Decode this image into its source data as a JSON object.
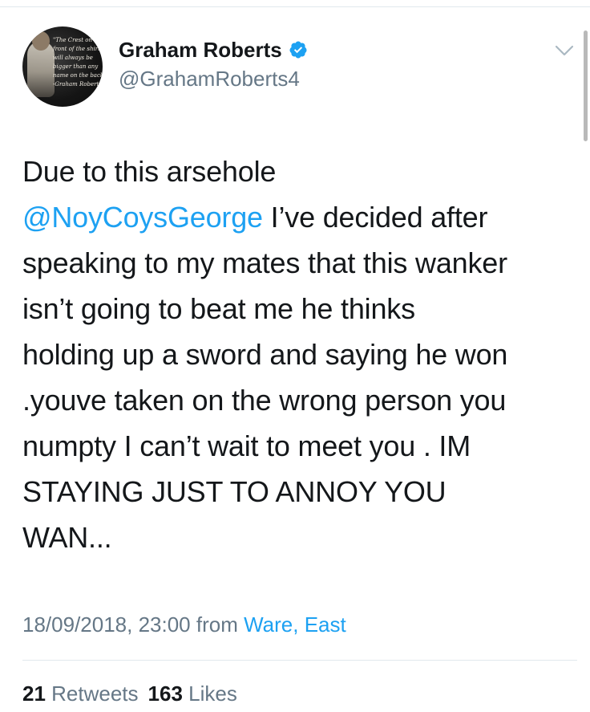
{
  "user": {
    "display_name": "Graham Roberts",
    "handle": "@GrahamRoberts4",
    "verified": true,
    "avatar_quote": [
      "\"The Crest on the",
      "front of the shirt",
      "will always be",
      "bigger than any",
      "name on the back\"",
      "-Graham Roberts"
    ]
  },
  "tweet": {
    "lines": [
      {
        "text": "Due to this arsehole"
      },
      {
        "mention": "@NoyCoysGeorge",
        "text": " I’ve decided after"
      },
      {
        "text": "speaking to my mates that this wanker"
      },
      {
        "text": "isn’t going to beat me he thinks"
      },
      {
        "text": "holding up a sword and saying he won"
      },
      {
        "text": ".youve taken on the wrong person you"
      },
      {
        "text": "numpty I can’t wait to meet you . IM"
      },
      {
        "text": "STAYING JUST TO ANNOY YOU"
      },
      {
        "text": "WAN..."
      }
    ]
  },
  "meta": {
    "timestamp": "18/09/2018, 23:00",
    "from_label": " from ",
    "location": "Ware, East"
  },
  "stats": {
    "retweets_count": "21",
    "retweets_label": " Retweets",
    "likes_count": "163",
    "likes_label": " Likes"
  },
  "colors": {
    "link": "#1da1f2",
    "secondary_text": "#657786",
    "primary_text": "#14171a",
    "verified_badge": "#1da1f2"
  },
  "icons": {
    "verified": "verified-badge-icon",
    "more": "chevron-down-icon"
  }
}
